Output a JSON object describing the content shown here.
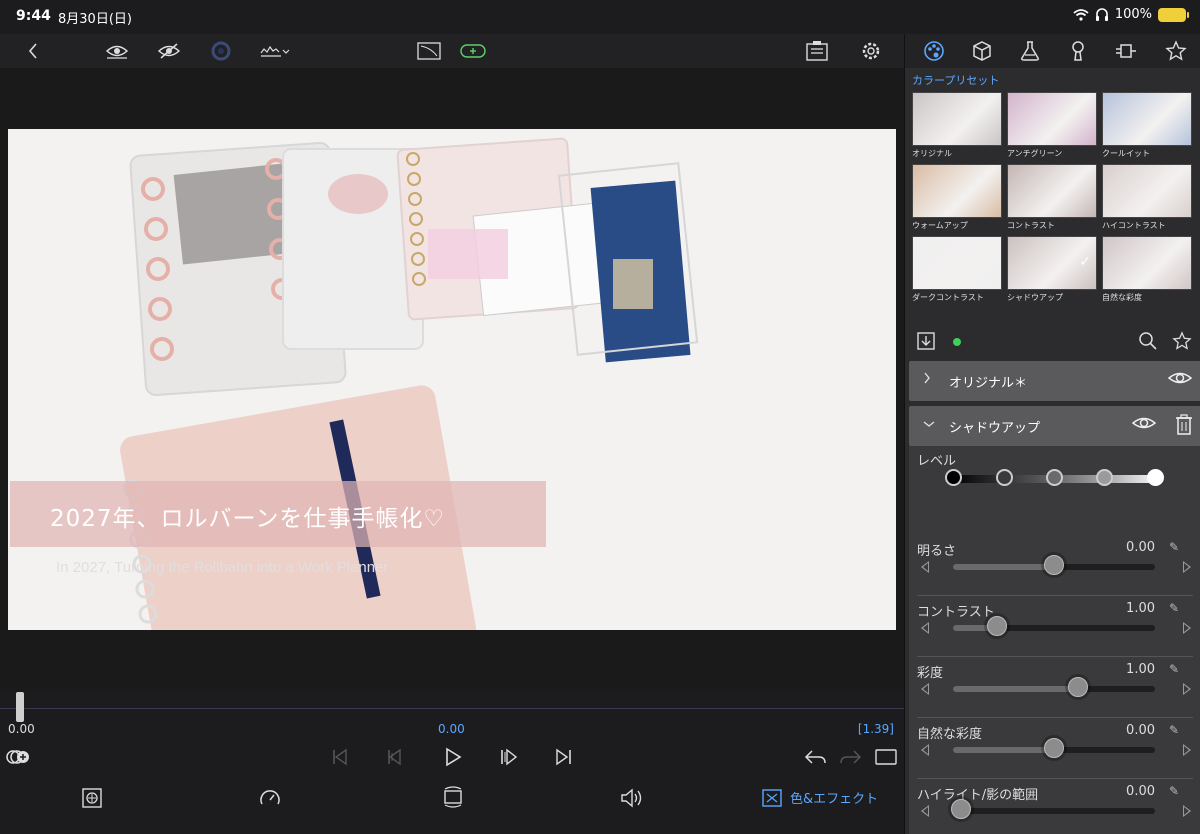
{
  "status_bar": {
    "time": "9:44",
    "date": "8月30日(日)",
    "battery": "100%"
  },
  "editor": {
    "caption_ja": "2027年、ロルバーンを仕事手帳化♡",
    "caption_en": "In 2027, Turning the Rollbahn into a Work Planner"
  },
  "timeline": {
    "left_tc": "0.00",
    "current_tc": "0.00",
    "duration_tc": "[1.39]"
  },
  "bottom": {
    "color_effects_label": "色&エフェクト"
  },
  "right_panel": {
    "preset_section_title": "カラープリセット",
    "presets": [
      {
        "label": "オリジナル",
        "tint": "#c9c5c4",
        "selected": false
      },
      {
        "label": "アンチグリーン",
        "tint": "#d3b4cc",
        "selected": false
      },
      {
        "label": "クールイット",
        "tint": "#b6c3dc",
        "selected": false
      },
      {
        "label": "ウォームアップ",
        "tint": "#d9bca4",
        "selected": false
      },
      {
        "label": "コントラスト",
        "tint": "#c4b6b4",
        "selected": false
      },
      {
        "label": "ハイコントラスト",
        "tint": "#d8cfcd",
        "selected": false
      },
      {
        "label": "ダークコントラスト",
        "tint": "#efefef",
        "selected": false
      },
      {
        "label": "シャドウアップ",
        "tint": "#cbc1c0",
        "selected": true
      },
      {
        "label": "自然な彩度",
        "tint": "#d0c6c6",
        "selected": false
      }
    ],
    "layers": [
      {
        "name": "オリジナル＊",
        "expanded": false
      },
      {
        "name": "シャドウアップ",
        "expanded": true
      }
    ],
    "level_label": "レベル",
    "level_selected_index": 4,
    "params": [
      {
        "name": "明るさ",
        "value": "0.00",
        "position": 0.5
      },
      {
        "name": "コントラスト",
        "value": "1.00",
        "position": 0.22
      },
      {
        "name": "彩度",
        "value": "1.00",
        "position": 0.62
      },
      {
        "name": "自然な彩度",
        "value": "0.00",
        "position": 0.5
      },
      {
        "name": "ハイライト/影の範囲",
        "value": "0.00",
        "position": 0.04
      }
    ]
  },
  "colors": {
    "accent": "#5aa7ff",
    "status_green": "#3ecf5a",
    "battery": "#f0d03a"
  }
}
